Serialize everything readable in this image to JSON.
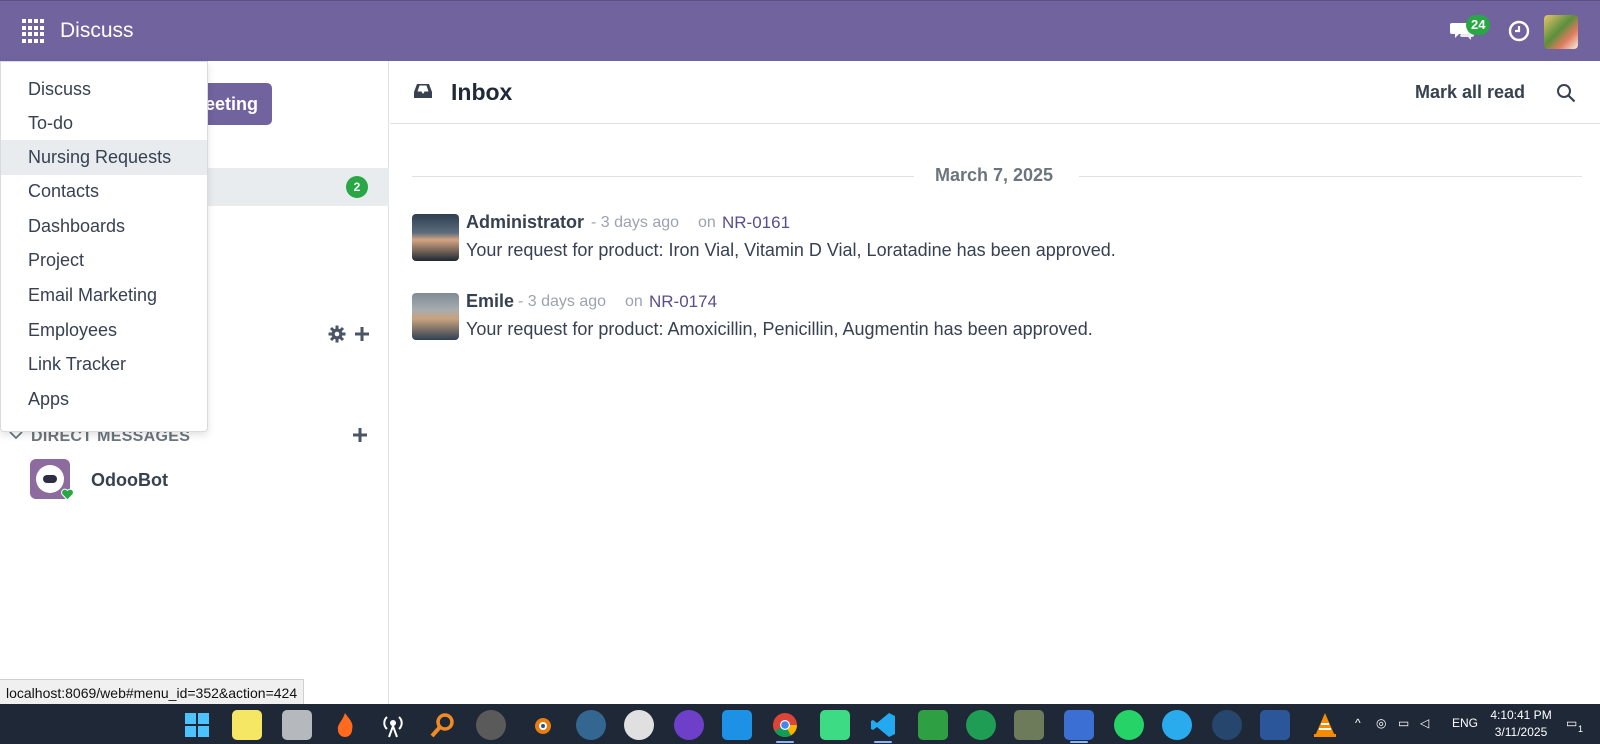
{
  "navbar": {
    "app_title": "Discuss",
    "chat_count": "24",
    "colors": {
      "bar": "#71639e",
      "badge": "#28a745"
    }
  },
  "app_menu": {
    "items": [
      {
        "label": "Discuss"
      },
      {
        "label": "To-do"
      },
      {
        "label": "Nursing Requests",
        "hovered": true
      },
      {
        "label": "Contacts"
      },
      {
        "label": "Dashboards"
      },
      {
        "label": "Project"
      },
      {
        "label": "Email Marketing"
      },
      {
        "label": "Employees"
      },
      {
        "label": "Link Tracker"
      },
      {
        "label": "Apps"
      }
    ]
  },
  "sidebar": {
    "meeting_button_partial": "eeting",
    "inbox_count": "2",
    "direct_messages_title": "DIRECT MESSAGES",
    "direct_messages": [
      {
        "name": "OdooBot",
        "status": "online"
      }
    ]
  },
  "main": {
    "title": "Inbox",
    "mark_all_read": "Mark all read",
    "date_separator": "March 7, 2025",
    "messages": [
      {
        "author": "Administrator",
        "time": "- 3 days ago",
        "on": "on",
        "record": "NR-0161",
        "body": "Your request for product: Iron Vial, Vitamin D Vial, Loratadine has been approved."
      },
      {
        "author": "Emile",
        "time": "- 3 days ago",
        "on": "on",
        "record": "NR-0174",
        "body": "Your request for product: Amoxicillin, Penicillin, Augmentin has been approved."
      }
    ]
  },
  "status_url": "localhost:8069/web#menu_id=352&action=424",
  "taskbar": {
    "tray_lang": "ENG",
    "time": "4:10:41 PM",
    "date": "3/11/2025",
    "notification_count": "1"
  }
}
